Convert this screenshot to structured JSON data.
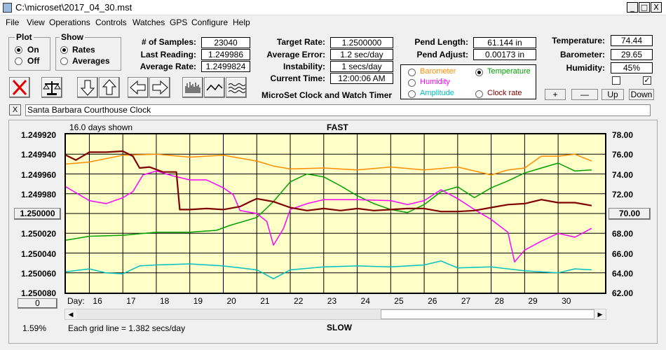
{
  "window": {
    "title": "C:\\microset\\2017_04_30.mst",
    "min": "_",
    "max": "□",
    "close": "X"
  },
  "menu": [
    "File",
    "View",
    "Operations",
    "Controls",
    "Watches",
    "GPS",
    "Configure",
    "Help"
  ],
  "plot_group": {
    "label": "Plot",
    "on": "On",
    "off": "Off"
  },
  "show_group": {
    "label": "Show",
    "rates": "Rates",
    "averages": "Averages"
  },
  "stats": {
    "samples_label": "# of Samples:",
    "samples": "23040",
    "last_label": "Last Reading:",
    "last": "1.249986",
    "avg_label": "Average Rate:",
    "avg": "1.2499824"
  },
  "rates": {
    "target_label": "Target Rate:",
    "target": "1.2500000",
    "error_label": "Average Error:",
    "error": "1.2 sec/day",
    "instab_label": "Instability:",
    "instab": "1 secs/day",
    "time_label": "Current Time:",
    "time": "12:00:06 AM"
  },
  "app_title": "MicroSet Clock and Watch Timer",
  "pendulum": {
    "length_label": "Pend Length:",
    "length": "61.144 in",
    "adjust_label": "Pend Adjust:",
    "adjust": "0.00173 in"
  },
  "env": {
    "temp_label": "Temperature:",
    "temp": "74.44",
    "baro_label": "Barometer:",
    "baro": "29.65",
    "hum_label": "Humidity:",
    "hum": "45%"
  },
  "overlay": {
    "barometer": "Barometer",
    "temperature": "Temperature",
    "humidity": "Humidity",
    "amplitude": "Amplitude",
    "clock_rate": "Clock rate",
    "colors": {
      "barometer": "#ff8c00",
      "temperature": "#00a000",
      "humidity": "#ff00ff",
      "amplitude": "#00c0c0",
      "clock_rate": "#800000"
    }
  },
  "small_buttons": {
    "plus": "+",
    "minus": "—",
    "up": "Up",
    "down": "Down"
  },
  "watch_name": "Santa Barbara Courthouse Clock",
  "close_x": "X",
  "chart_data": {
    "type": "line",
    "days_shown": "16.0 days shown",
    "top_label": "FAST",
    "bottom_label": "SLOW",
    "grid_note": "Each grid line = 1.382 secs/day",
    "left_ticks": [
      "1.249920",
      "1.249940",
      "1.249960",
      "1.249980",
      "1.250000",
      "1.250020",
      "1.250040",
      "1.250060",
      "1.250080"
    ],
    "right_ticks": [
      "78.00",
      "76.00",
      "74.00",
      "72.00",
      "70.00",
      "68.00",
      "66.00",
      "64.00",
      "62.00"
    ],
    "xlabel": "Day:",
    "days": [
      "16",
      "17",
      "18",
      "19",
      "20",
      "21",
      "22",
      "23",
      "24",
      "25",
      "26",
      "27",
      "28",
      "29",
      "30"
    ],
    "left_button": "1.250000",
    "right_button": "70.00",
    "zero_button": "0",
    "percent": "1.59%",
    "xlim": [
      15.3,
      31.4
    ],
    "left_ylim": [
      1.24992,
      1.25008
    ],
    "right_ylim": [
      62,
      78
    ],
    "series": [
      {
        "name": "Clock rate",
        "color": "#800000",
        "axis": "left",
        "x": [
          15.3,
          15.6,
          16.0,
          16.5,
          17.0,
          17.3,
          17.5,
          17.8,
          18.2,
          18.6,
          18.7,
          19.0,
          19.5,
          20.0,
          20.5,
          20.8,
          21.0,
          21.5,
          22.0,
          22.5,
          23.0,
          23.5,
          24.0,
          24.5,
          25.0,
          25.5,
          26.0,
          26.5,
          27.0,
          27.5,
          28.0,
          28.5,
          29.0,
          29.5,
          30.0,
          30.5,
          31.0
        ],
        "y": [
          1.249941,
          1.249946,
          1.249938,
          1.249938,
          1.249937,
          1.249942,
          1.249954,
          1.249953,
          1.249958,
          1.249958,
          1.249996,
          1.249996,
          1.249995,
          1.249996,
          1.249993,
          1.249988,
          1.249985,
          1.249988,
          1.249994,
          1.249997,
          1.249995,
          1.249997,
          1.249995,
          1.249997,
          1.249996,
          1.249995,
          1.249995,
          1.249998,
          1.249998,
          1.249997,
          1.249994,
          1.249991,
          1.24999,
          1.249986,
          1.249989,
          1.249989,
          1.249992
        ]
      },
      {
        "name": "Barometer",
        "color": "#ff8c00",
        "axis": "right",
        "x": [
          15.3,
          16.0,
          17.0,
          18.0,
          19.0,
          20.0,
          21.0,
          21.5,
          22.0,
          23.0,
          24.0,
          25.0,
          26.0,
          27.0,
          28.0,
          28.5,
          29.0,
          29.5,
          30.0,
          30.5,
          31.0
        ],
        "y": [
          75.0,
          75.2,
          75.9,
          76.0,
          75.7,
          75.9,
          75.3,
          74.8,
          74.5,
          74.6,
          74.4,
          74.7,
          74.4,
          74.7,
          73.9,
          74.4,
          74.6,
          75.8,
          75.8,
          76.0,
          75.3
        ]
      },
      {
        "name": "Temperature",
        "color": "#00a000",
        "axis": "right",
        "x": [
          15.3,
          16.0,
          17.0,
          18.0,
          19.0,
          19.8,
          20.2,
          21.0,
          21.5,
          22.0,
          22.5,
          23.0,
          23.5,
          24.0,
          24.5,
          25.0,
          25.5,
          26.0,
          26.5,
          27.0,
          27.5,
          28.0,
          28.5,
          29.0,
          29.5,
          30.0,
          30.5,
          31.0
        ],
        "y": [
          67.3,
          67.7,
          67.8,
          68.1,
          68.1,
          68.3,
          68.8,
          69.6,
          71.2,
          73.2,
          74.0,
          73.7,
          72.8,
          71.8,
          71.0,
          70.4,
          70.1,
          70.9,
          72.2,
          72.7,
          71.6,
          72.6,
          73.3,
          74.1,
          74.6,
          75.1,
          74.3,
          74.4
        ]
      },
      {
        "name": "Humidity",
        "color": "#ff00ff",
        "axis": "right",
        "x": [
          15.3,
          16.0,
          16.5,
          17.0,
          17.3,
          17.6,
          18.0,
          18.5,
          19.0,
          19.5,
          20.0,
          20.3,
          20.5,
          21.0,
          21.3,
          21.5,
          21.8,
          22.0,
          22.5,
          23.0,
          24.0,
          25.0,
          25.5,
          26.0,
          26.5,
          27.0,
          27.5,
          28.0,
          28.5,
          28.7,
          29.0,
          29.5,
          30.0,
          30.5,
          31.0
        ],
        "y": [
          72.7,
          71.3,
          71.0,
          71.6,
          72.2,
          73.9,
          74.3,
          73.8,
          73.4,
          73.4,
          72.6,
          71.9,
          70.3,
          70.0,
          69.2,
          66.8,
          68.5,
          70.4,
          71.0,
          71.4,
          71.4,
          71.3,
          70.9,
          71.3,
          72.4,
          71.5,
          70.4,
          69.4,
          68.1,
          65.1,
          66.3,
          67.2,
          68.0,
          67.6,
          68.5
        ]
      },
      {
        "name": "Amplitude",
        "color": "#00c0c0",
        "axis": "right",
        "x": [
          15.3,
          16.0,
          16.5,
          17.0,
          17.5,
          18.0,
          19.0,
          20.0,
          21.0,
          21.5,
          22.0,
          23.0,
          24.0,
          25.0,
          26.0,
          26.5,
          27.0,
          28.0,
          29.0,
          30.0,
          30.5,
          31.0
        ],
        "y": [
          64.1,
          64.4,
          64.0,
          63.9,
          64.7,
          64.8,
          64.9,
          64.7,
          64.3,
          63.4,
          64.3,
          64.6,
          64.7,
          64.6,
          64.8,
          65.2,
          64.5,
          64.6,
          64.2,
          64.0,
          64.4,
          64.3
        ]
      }
    ]
  }
}
